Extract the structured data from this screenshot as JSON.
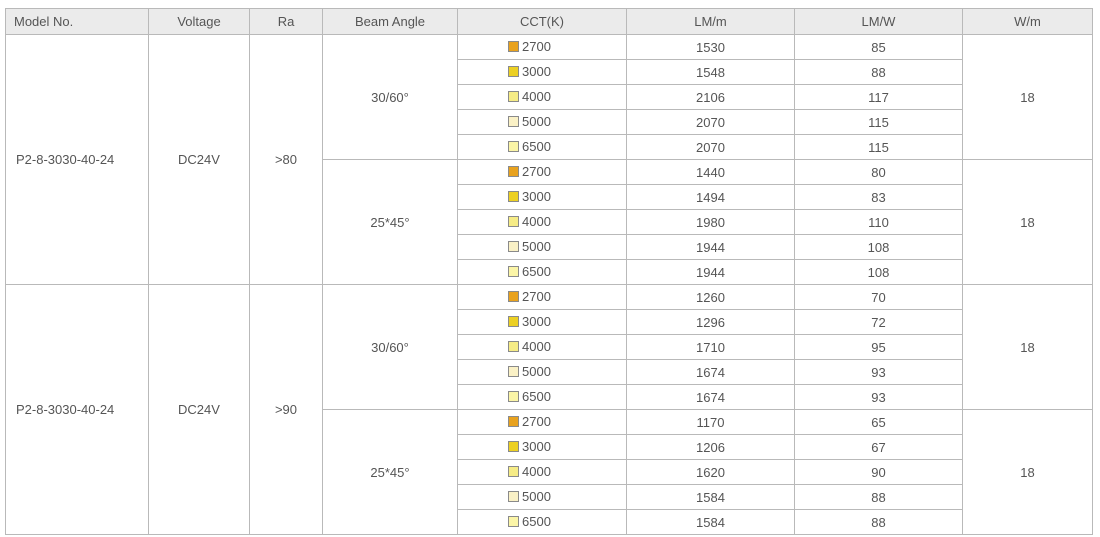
{
  "table": {
    "headers": [
      "Model No.",
      "Voltage",
      "Ra",
      "Beam Angle",
      "CCT(K)",
      "LM/m",
      "LM/W",
      "W/m"
    ],
    "colors": {
      "2700": "#e8a21e",
      "3000": "#ecd023",
      "4000": "#f6ec86",
      "5000": "#faf1c6",
      "6500": "#fbf5a7"
    },
    "groups": [
      {
        "model": "P2-8-3030-40-24",
        "voltage": "DC24V",
        "ra": ">80",
        "beams": [
          {
            "angle": "30/60°",
            "watt": "18",
            "rows": [
              {
                "cct": "2700",
                "lm_m": "1530",
                "lm_w": "85"
              },
              {
                "cct": "3000",
                "lm_m": "1548",
                "lm_w": "88"
              },
              {
                "cct": "4000",
                "lm_m": "2106",
                "lm_w": "117"
              },
              {
                "cct": "5000",
                "lm_m": "2070",
                "lm_w": "115"
              },
              {
                "cct": "6500",
                "lm_m": "2070",
                "lm_w": "115"
              }
            ]
          },
          {
            "angle": "25*45°",
            "watt": "18",
            "rows": [
              {
                "cct": "2700",
                "lm_m": "1440",
                "lm_w": "80"
              },
              {
                "cct": "3000",
                "lm_m": "1494",
                "lm_w": "83"
              },
              {
                "cct": "4000",
                "lm_m": "1980",
                "lm_w": "110"
              },
              {
                "cct": "5000",
                "lm_m": "1944",
                "lm_w": "108"
              },
              {
                "cct": "6500",
                "lm_m": "1944",
                "lm_w": "108"
              }
            ]
          }
        ]
      },
      {
        "model": "P2-8-3030-40-24",
        "voltage": "DC24V",
        "ra": ">90",
        "beams": [
          {
            "angle": "30/60°",
            "watt": "18",
            "rows": [
              {
                "cct": "2700",
                "lm_m": "1260",
                "lm_w": "70"
              },
              {
                "cct": "3000",
                "lm_m": "1296",
                "lm_w": "72"
              },
              {
                "cct": "4000",
                "lm_m": "1710",
                "lm_w": "95"
              },
              {
                "cct": "5000",
                "lm_m": "1674",
                "lm_w": "93"
              },
              {
                "cct": "6500",
                "lm_m": "1674",
                "lm_w": "93"
              }
            ]
          },
          {
            "angle": "25*45°",
            "watt": "18",
            "rows": [
              {
                "cct": "2700",
                "lm_m": "1170",
                "lm_w": "65"
              },
              {
                "cct": "3000",
                "lm_m": "1206",
                "lm_w": "67"
              },
              {
                "cct": "4000",
                "lm_m": "1620",
                "lm_w": "90"
              },
              {
                "cct": "5000",
                "lm_m": "1584",
                "lm_w": "88"
              },
              {
                "cct": "6500",
                "lm_m": "1584",
                "lm_w": "88"
              }
            ]
          }
        ]
      }
    ]
  }
}
